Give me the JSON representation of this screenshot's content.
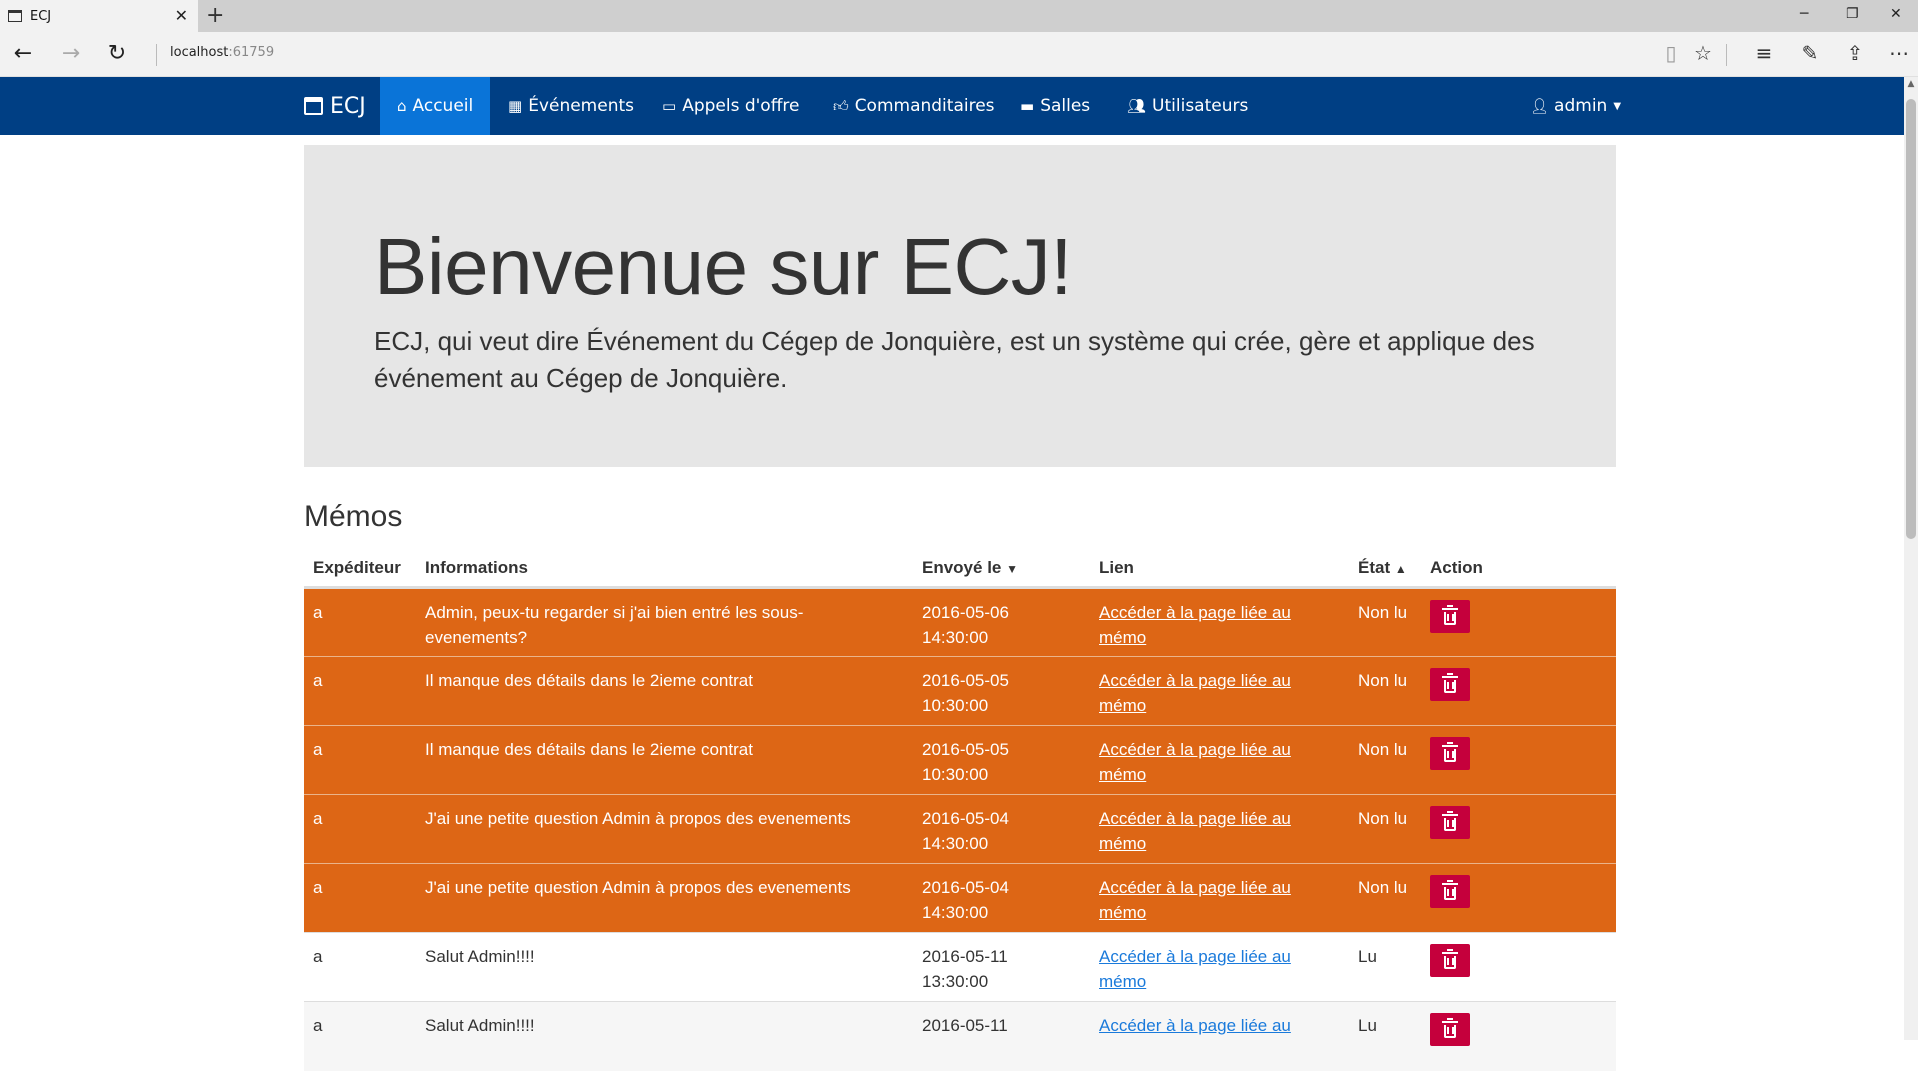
{
  "browser": {
    "tab_title": "ECJ",
    "url_host": "localhost",
    "url_port": ":61759"
  },
  "navbar": {
    "brand": "ECJ",
    "items": [
      {
        "label": "Accueil",
        "icon": "home-icon",
        "active": true
      },
      {
        "label": "Événements",
        "icon": "calendar-icon"
      },
      {
        "label": "Appels d'offre",
        "icon": "monitor-icon"
      },
      {
        "label": "Commanditaires",
        "icon": "thumbs-up-icon"
      },
      {
        "label": "Salles",
        "icon": "bed-icon"
      },
      {
        "label": "Utilisateurs",
        "icon": "users-icon"
      }
    ],
    "user": "admin"
  },
  "jumbotron": {
    "title": "Bienvenue sur ECJ!",
    "text": "ECJ, qui veut dire Événement du Cégep de Jonquière, est un système qui crée, gère et applique des événement au Cégep de Jonquière."
  },
  "memos": {
    "title": "Mémos",
    "headers": {
      "sender": "Expéditeur",
      "info": "Informations",
      "sent": "Envoyé le",
      "sent_sort": "▼",
      "link": "Lien",
      "state": "État",
      "state_sort": "▲",
      "action": "Action"
    },
    "rows": [
      {
        "sender": "a",
        "info": "Admin, peux-tu regarder si j'ai bien entré les sous-evenements?",
        "date": "2016-05-06",
        "time": "14:30:00",
        "link": "Accéder à la page liée au mémo",
        "state": "Non lu",
        "read": false
      },
      {
        "sender": "a",
        "info": "Il manque des détails dans le 2ieme contrat",
        "date": "2016-05-05",
        "time": "10:30:00",
        "link": "Accéder à la page liée au mémo",
        "state": "Non lu",
        "read": false
      },
      {
        "sender": "a",
        "info": "Il manque des détails dans le 2ieme contrat",
        "date": "2016-05-05",
        "time": "10:30:00",
        "link": "Accéder à la page liée au mémo",
        "state": "Non lu",
        "read": false
      },
      {
        "sender": "a",
        "info": "J'ai une petite question Admin à propos des evenements",
        "date": "2016-05-04",
        "time": "14:30:00",
        "link": "Accéder à la page liée au mémo",
        "state": "Non lu",
        "read": false
      },
      {
        "sender": "a",
        "info": "J'ai une petite question Admin à propos des evenements",
        "date": "2016-05-04",
        "time": "14:30:00",
        "link": "Accéder à la page liée au mémo",
        "state": "Non lu",
        "read": false
      },
      {
        "sender": "a",
        "info": "Salut Admin!!!!",
        "date": "2016-05-11",
        "time": "13:30:00",
        "link": "Accéder à la page liée au mémo",
        "state": "Lu",
        "read": true
      },
      {
        "sender": "a",
        "info": "Salut Admin!!!!",
        "date": "2016-05-11",
        "time": "",
        "link": "Accéder à la page liée au",
        "state": "Lu",
        "read": true
      }
    ]
  },
  "colors": {
    "navbar": "#003f84",
    "nav_active": "#0a74d8",
    "unread_row": "#dd6615",
    "delete_button": "#c5003c",
    "link": "#1a7adb"
  }
}
